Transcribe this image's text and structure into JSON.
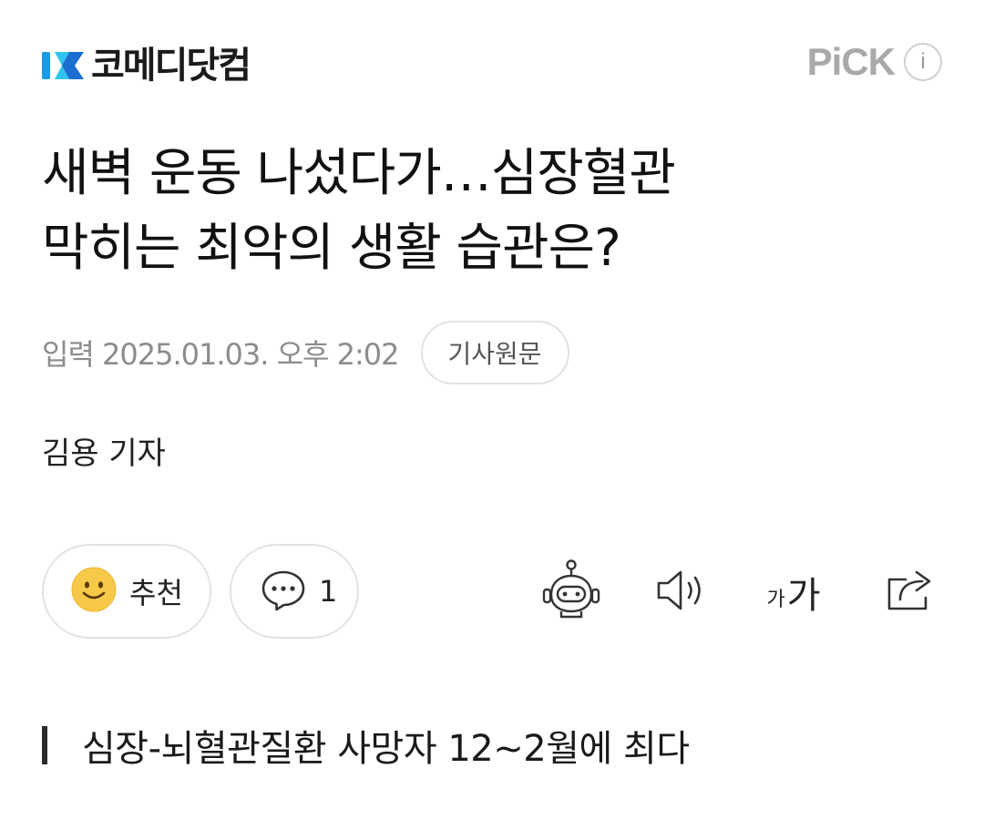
{
  "header": {
    "brand_name": "코메디닷컴",
    "pick_label": "PiCK",
    "info_label": "i"
  },
  "article": {
    "title_lines": [
      "새벽 운동 나섰다가…심장혈관",
      "막히는 최악의 생활 습관은?"
    ],
    "published": "입력 2025.01.03. 오후 2:02",
    "source_button": "기사원문",
    "byline": "김용 기자",
    "subtitle": "심장-뇌혈관질환 사망자 12~2월에 최다"
  },
  "actions": {
    "like_label": "추천",
    "comment_count": "1",
    "font_size_small": "가",
    "font_size_large": "가"
  },
  "icons": {
    "brand": "komedi-logo-icon",
    "like": "smiley-icon",
    "comment": "speech-bubble-icon",
    "summary_bot": "robot-icon",
    "tts": "speaker-icon",
    "share": "share-icon"
  },
  "colors": {
    "brand_blue": "#1a9be6",
    "brand_cyan": "#2ec4ef",
    "muted_text": "#8c8c8c",
    "smiley": "#f7c948"
  }
}
